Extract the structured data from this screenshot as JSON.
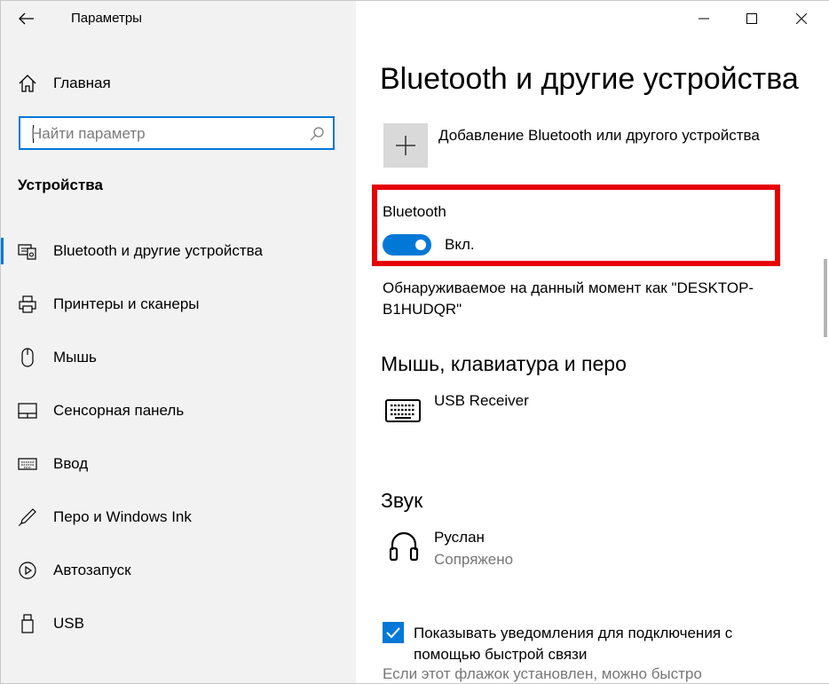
{
  "app": {
    "title": "Параметры"
  },
  "sidebar": {
    "home_label": "Главная",
    "search_placeholder": "Найти параметр",
    "section_heading": "Устройства",
    "items": [
      {
        "label": "Bluetooth и другие устройства",
        "icon": "bluetooth-devices-icon",
        "active": true
      },
      {
        "label": "Принтеры и сканеры",
        "icon": "printer-icon"
      },
      {
        "label": "Мышь",
        "icon": "mouse-icon"
      },
      {
        "label": "Сенсорная панель",
        "icon": "touchpad-icon"
      },
      {
        "label": "Ввод",
        "icon": "keyboard-icon"
      },
      {
        "label": "Перо и Windows Ink",
        "icon": "pen-icon"
      },
      {
        "label": "Автозапуск",
        "icon": "autoplay-icon"
      },
      {
        "label": "USB",
        "icon": "usb-icon"
      }
    ]
  },
  "main": {
    "title": "Bluetooth и другие устройства",
    "add_device_label": "Добавление Bluetooth или другого устройства",
    "bluetooth": {
      "label": "Bluetooth",
      "state": "Вкл.",
      "on": true
    },
    "discoverable_text": "Обнаруживаемое на данный момент как \"DESKTOP-B1HUDQR\"",
    "sections": [
      {
        "heading": "Мышь, клавиатура и перо",
        "devices": [
          {
            "name": "USB Receiver",
            "icon": "keyboard-icon"
          }
        ]
      },
      {
        "heading": "Звук",
        "devices": [
          {
            "name": "Руслан",
            "status": "Сопряжено",
            "icon": "headphones-icon"
          }
        ]
      }
    ],
    "notifications_checkbox": {
      "label": "Показывать уведомления для подключения с помощью быстрой связи",
      "checked": true,
      "description": "Если этот флажок установлен, можно быстро"
    }
  },
  "colors": {
    "accent": "#0078d7",
    "highlight_frame": "#e60000",
    "sidebar_bg": "#f2f2f2"
  }
}
